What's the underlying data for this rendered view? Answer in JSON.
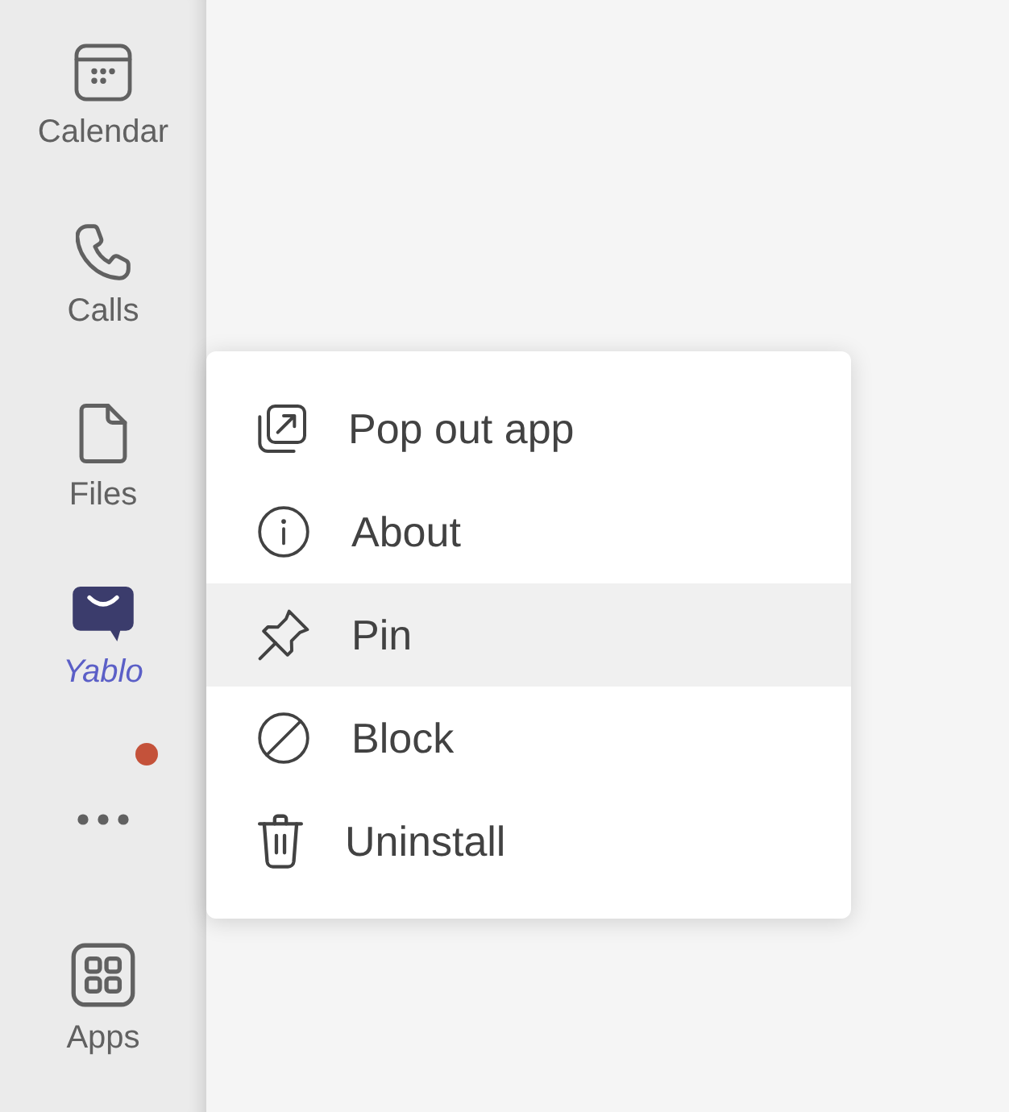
{
  "sidebar": {
    "items": [
      {
        "kind": "app",
        "label": "Calendar",
        "selected": false,
        "notification": false
      },
      {
        "kind": "app",
        "label": "Calls",
        "selected": false,
        "notification": false
      },
      {
        "kind": "app",
        "label": "Files",
        "selected": false,
        "notification": false
      },
      {
        "kind": "app",
        "label": "Yablo",
        "selected": true,
        "notification": false
      },
      {
        "kind": "more",
        "selected": false,
        "notification": true
      },
      {
        "kind": "app",
        "label": "Apps",
        "selected": false,
        "notification": false
      }
    ]
  },
  "context_menu": {
    "items": [
      {
        "label": "Pop out app",
        "selected": false
      },
      {
        "label": "About",
        "selected": false
      },
      {
        "label": "Pin",
        "selected": true
      },
      {
        "label": "Block",
        "selected": false
      },
      {
        "label": "Uninstall",
        "selected": false
      }
    ]
  }
}
